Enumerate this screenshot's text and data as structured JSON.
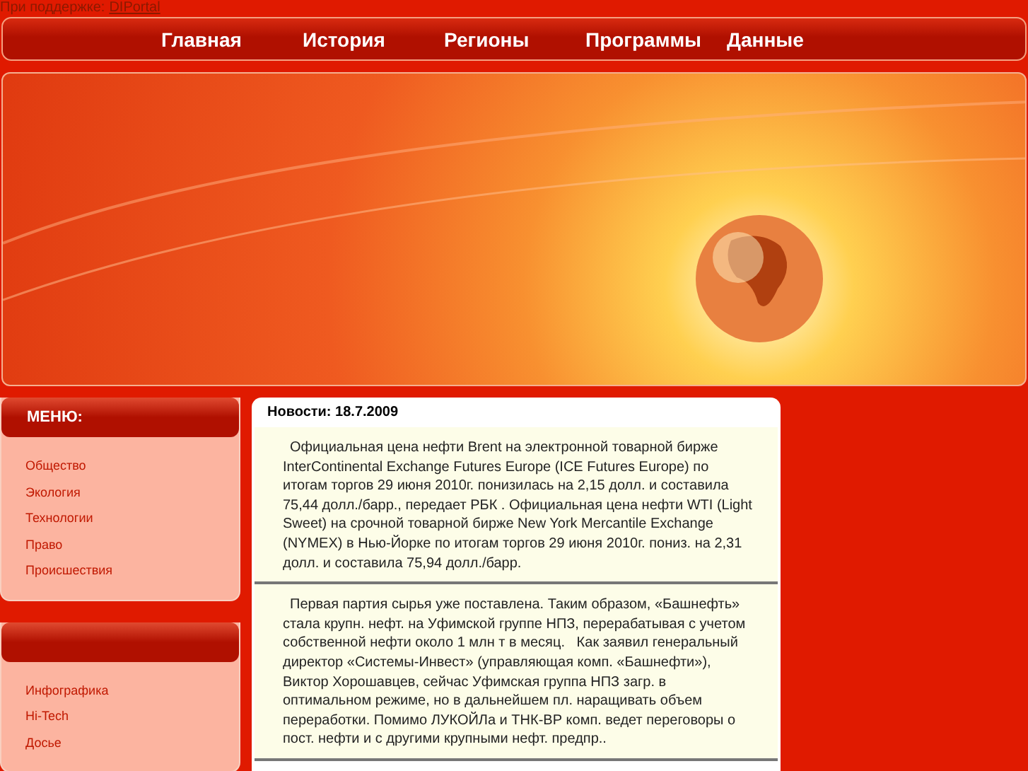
{
  "support": {
    "label": "При поддержке:",
    "link": "DIPortal"
  },
  "nav": [
    "Главная",
    "История",
    "Регионы",
    "Программы",
    "Данные"
  ],
  "sidebar": [
    {
      "title": "МЕНЮ:",
      "items": [
        "Общество",
        "Экология",
        "Технологии",
        "Право",
        "Происшествия"
      ]
    },
    {
      "items": [
        "Инфографика",
        "Hi-Tech",
        "Досье"
      ]
    }
  ],
  "news": {
    "title": "Новости: 18.7.2009",
    "items": [
      "Официальная цена нефти Brent на электронной товарной бирже InterContinental Exchange Futures Europe (ICE Futures Europe) по итогам торгов 29 июня 2010г. понизилась на 2,15 долл. и составила 75,44 долл./барр., передает РБК . Официальная цена нефти WTI (Light Sweet) на срочной товарной бирже New York Mercantile Exchange (NYMEX) в Нью-Йорке по итогам торгов 29 июня 2010г. пониз. на 2,31 долл. и составила 75,94 долл./барр.",
      "Первая партия сырья уже поставлена. Таким образом, «Башнефть» стала крупн. нефт. на Уфимской группе НПЗ, перерабатывая с учетом собственной нефти около 1 млн т в месяц.   Как заявил генеральный директор «Системы-Инвест» (управляющая комп. «Башнефти»), Виктор Хорошавцев, сейчас Уфимская группа НПЗ загр. в оптимальном режиме, но в дальнейшем пл. наращивать объем переработки. Помимо ЛУКОЙЛа и ТНК-ВР комп. ведет переговоры о пост. нефти и с другими крупными нефт. предпр.."
    ]
  }
}
